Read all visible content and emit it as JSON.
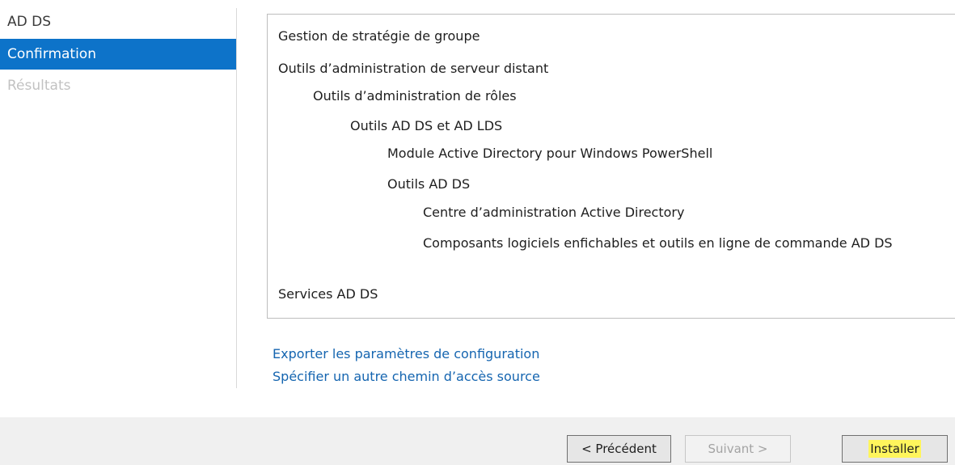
{
  "nav": {
    "items": [
      {
        "label": "AD DS",
        "state": "completed"
      },
      {
        "label": "Confirmation",
        "state": "active"
      },
      {
        "label": "Résultats",
        "state": "disabled"
      }
    ]
  },
  "features": [
    {
      "label": "Gestion de stratégie de groupe",
      "level": 0
    },
    {
      "label": "Outils d’administration de serveur distant",
      "level": 0
    },
    {
      "label": "Outils d’administration de rôles",
      "level": 1
    },
    {
      "label": "Outils AD DS et AD LDS",
      "level": 2
    },
    {
      "label": "Module Active Directory pour Windows PowerShell",
      "level": 3
    },
    {
      "label": "Outils AD DS",
      "level": 3
    },
    {
      "label": "Centre d’administration Active Directory",
      "level": 4
    },
    {
      "label": "Composants logiciels enfichables et outils en ligne de commande AD DS",
      "level": 4
    },
    {
      "label": "Services AD DS",
      "level": 0
    }
  ],
  "links": {
    "export": "Exporter les paramètres de configuration",
    "source": "Spécifier un autre chemin d’accès source"
  },
  "buttons": {
    "previous": "< Précédent",
    "next": "Suivant >",
    "install": "Installer"
  },
  "colors": {
    "accent": "#0d73c9",
    "link": "#1565b0",
    "install_highlight": "#fff55c"
  }
}
